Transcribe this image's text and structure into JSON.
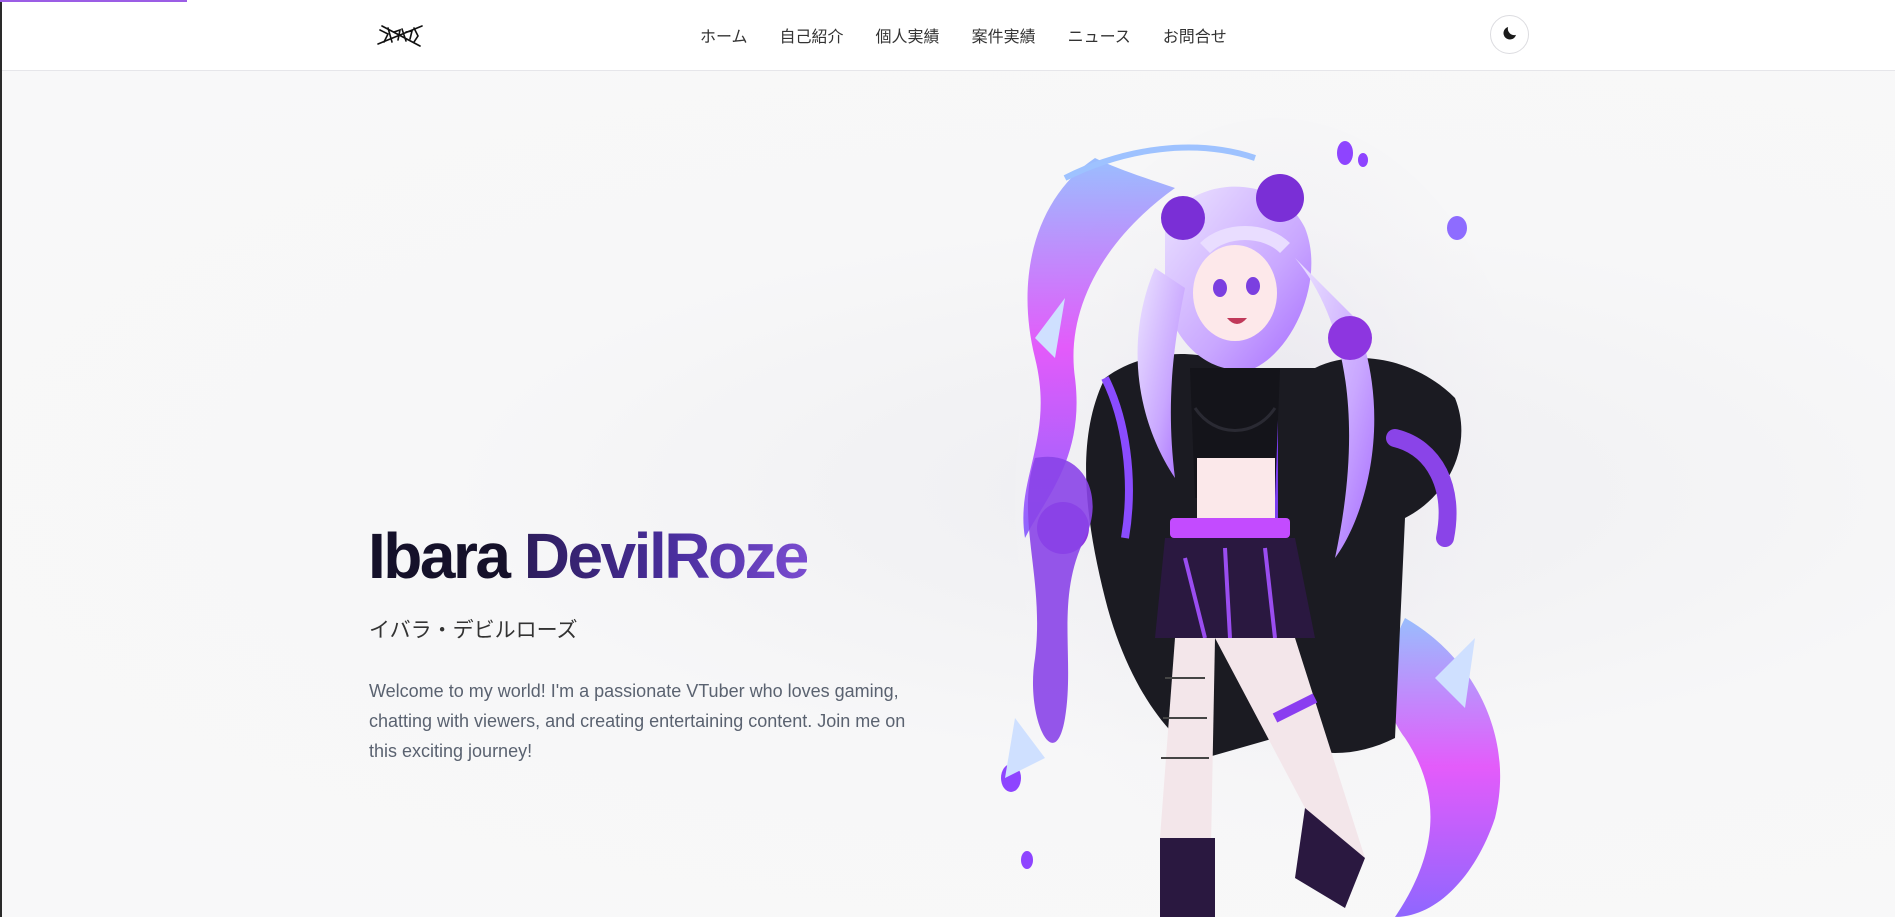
{
  "nav": {
    "items": [
      {
        "label": "ホーム"
      },
      {
        "label": "自己紹介"
      },
      {
        "label": "個人実績"
      },
      {
        "label": "案件実績"
      },
      {
        "label": "ニュース"
      },
      {
        "label": "お問合せ"
      }
    ],
    "theme_toggle_icon": "moon-icon"
  },
  "hero": {
    "name_part1": "Ibara ",
    "name_part2": "DevilRoze",
    "kana": "イバラ・デビルローズ",
    "intro": "Welcome to my world! I'm a passionate VTuber who loves gaming, chatting with viewers, and creating entertaining content. Join me on this exciting journey!"
  },
  "colors": {
    "accent": "#9b5de5",
    "name_dark": "#15112a",
    "name_gradient_start": "#2d1d5c",
    "name_gradient_end": "#7a4cd0",
    "body_text": "#5a6270"
  },
  "icons": [
    "logo-emblem-icon",
    "moon-icon"
  ],
  "progress_fraction": 0.1
}
